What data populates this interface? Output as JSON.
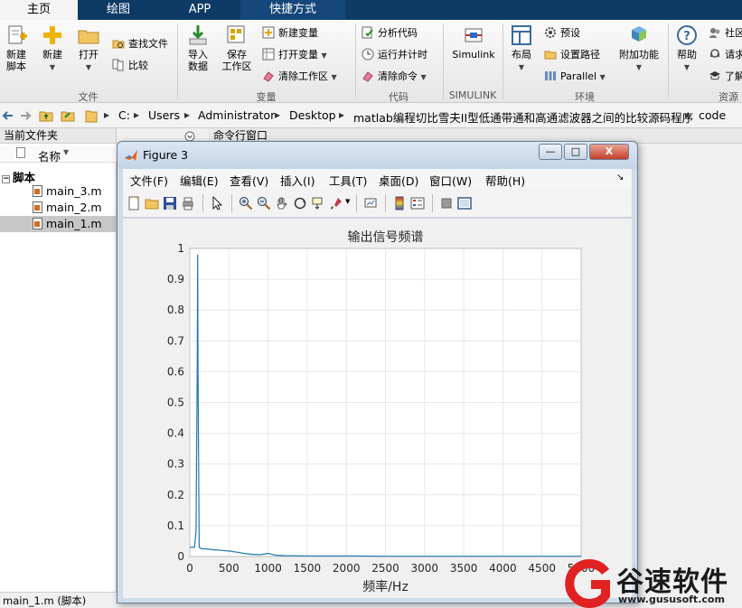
{
  "tabs": [
    {
      "label": "主页",
      "active": true
    },
    {
      "label": "绘图"
    },
    {
      "label": "APP"
    },
    {
      "label": "快捷方式"
    }
  ],
  "ribbon": {
    "file": {
      "title": "文件",
      "new_script": "新建\n脚本",
      "new": "新建",
      "open": "打开",
      "find_files": "查找文件",
      "compare": "比较"
    },
    "variable": {
      "title": "变量",
      "import_data": "导入\n数据",
      "save_workspace": "保存\n工作区",
      "new_variable": "新建变量",
      "open_variable": "打开变量",
      "clear_workspace": "清除工作区"
    },
    "code": {
      "title": "代码",
      "analyze_code": "分析代码",
      "run_and_time": "运行并计时",
      "clear_commands": "清除命令"
    },
    "simulink": {
      "title": "SIMULINK",
      "simulink": "Simulink"
    },
    "environment": {
      "title": "环境",
      "layout": "布局",
      "preferences": "预设",
      "set_path": "设置路径",
      "parallel": "Parallel",
      "add_ons": "附加功能"
    },
    "resources": {
      "title": "资源",
      "help": "帮助",
      "community": "社区",
      "request": "请求",
      "learn": "了解"
    }
  },
  "path": {
    "segments": [
      "C:",
      "Users",
      "Administrator",
      "Desktop",
      "matlab编程切比雪夫II型低通带通和高通滤波器之间的比较源码程序",
      "code"
    ]
  },
  "left_panel": {
    "header": "当前文件夹",
    "col_name": "名称",
    "folder": "脚本",
    "files": [
      "main_3.m",
      "main_2.m",
      "main_1.m"
    ],
    "selected_index": 2,
    "status": "main_1.m  (脚本)"
  },
  "command_window": {
    "header": "命令行窗口"
  },
  "figure": {
    "title": "Figure 3",
    "menu": [
      "文件(F)",
      "编辑(E)",
      "查看(V)",
      "插入(I)",
      "工具(T)",
      "桌面(D)",
      "窗口(W)",
      "帮助(H)"
    ],
    "window_buttons": {
      "minimize": "—",
      "maximize": "□",
      "close": "X"
    }
  },
  "chart_data": {
    "type": "line",
    "title": "输出信号频谱",
    "xlabel": "频率/Hz",
    "ylabel": "",
    "xlim": [
      0,
      5000
    ],
    "ylim": [
      0,
      1
    ],
    "xticks": [
      0,
      500,
      1000,
      1500,
      2000,
      2500,
      3000,
      3500,
      4000,
      4500,
      5000
    ],
    "yticks": [
      0,
      0.1,
      0.2,
      0.3,
      0.4,
      0.5,
      0.6,
      0.7,
      0.8,
      0.9,
      1
    ],
    "xtick_labels": [
      "0",
      "500",
      "1000",
      "1500",
      "2000",
      "2500",
      "3000",
      "3500",
      "4000",
      "4500",
      "5000"
    ],
    "ytick_labels": [
      "0",
      "0.1",
      "0.2",
      "0.3",
      "0.4",
      "0.5",
      "0.6",
      "0.7",
      "0.8",
      "0.9",
      "1"
    ],
    "grid": true,
    "line_color": "#1f77b4",
    "series": [
      {
        "x": [
          0,
          20,
          40,
          60,
          80,
          95,
          100,
          105,
          120,
          150,
          200,
          300,
          400,
          500,
          600,
          700,
          800,
          900,
          1000,
          1100,
          1200,
          1500,
          2000,
          2500,
          3000,
          3500,
          4000,
          4500,
          5000
        ],
        "y": [
          0.03,
          0.03,
          0.03,
          0.03,
          0.08,
          0.6,
          0.98,
          0.6,
          0.03,
          0.025,
          0.025,
          0.022,
          0.02,
          0.018,
          0.014,
          0.01,
          0.007,
          0.006,
          0.01,
          0.004,
          0.003,
          0.002,
          0.002,
          0.001,
          0.001,
          0.001,
          0.001,
          0.001,
          0.001
        ]
      }
    ]
  },
  "watermark": {
    "brand_cn": "谷速软件",
    "url": "www.gususoft.com"
  }
}
